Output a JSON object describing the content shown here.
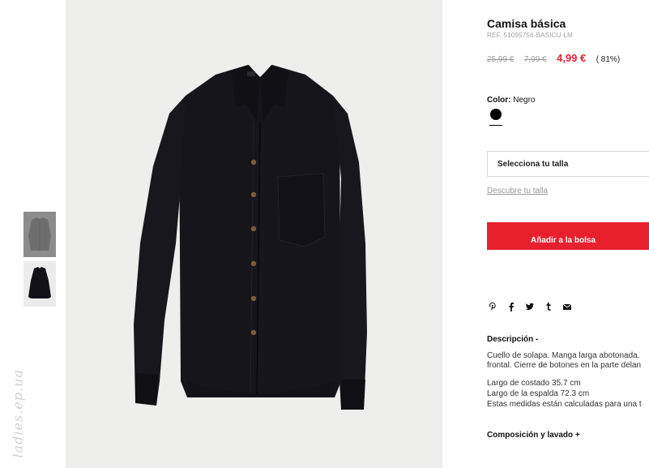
{
  "product": {
    "title": "Camisa básica",
    "ref": "REF. 51095756-BASICU-LM",
    "price_original": "25,99 €",
    "price_previous": "7,99 €",
    "price_current": "4,99 €",
    "discount": "( 81%)"
  },
  "color": {
    "label": "Color:",
    "value": "Negro",
    "swatch_hex": "#000000"
  },
  "size": {
    "select_label": "Selecciona tu talla",
    "guide_link": "Descubre tu talla"
  },
  "cart": {
    "add_label": "Añadir a la bolsa",
    "accent": "#e8202e"
  },
  "share": {
    "icons": [
      "pinterest-icon",
      "facebook-icon",
      "twitter-icon",
      "tumblr-icon",
      "email-icon"
    ]
  },
  "description": {
    "title": "Descripción  -",
    "lines": [
      "Cuello de solapa. Manga larga abotonada.",
      "frontal. Cierre de botones en la parte delan",
      "Largo de costado 35.7 cm",
      "Largo de la espalda 72.3 cm",
      "Estas medidas están calculadas para una t"
    ]
  },
  "composition": {
    "title": "Composición y lavado  +"
  },
  "watermark": "ladies.ep.ua"
}
